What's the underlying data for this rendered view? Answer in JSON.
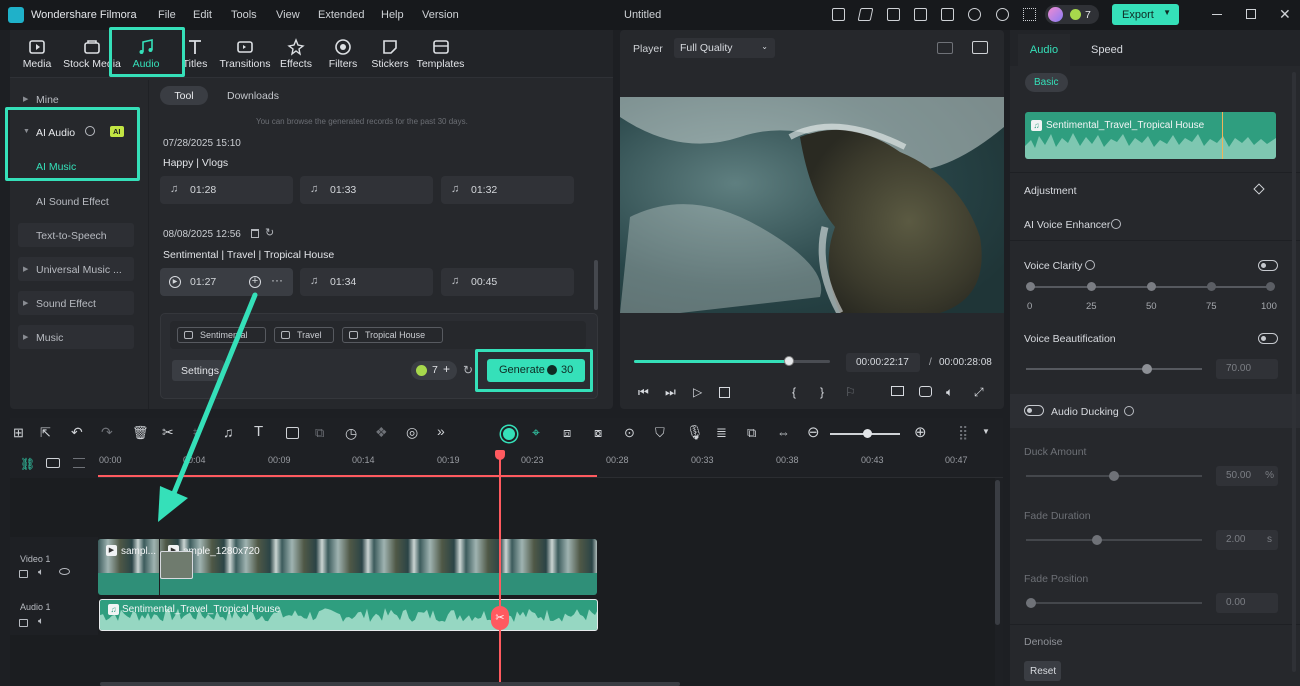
{
  "app": {
    "name": "Wondershare Filmora",
    "doc_title": "Untitled",
    "credits": "7",
    "export_label": "Export"
  },
  "menu": [
    "File",
    "Edit",
    "Tools",
    "View",
    "Extended",
    "Help",
    "Version"
  ],
  "toptabs": [
    "Media",
    "Stock Media",
    "Audio",
    "Titles",
    "Transitions",
    "Effects",
    "Filters",
    "Stickers",
    "Templates"
  ],
  "sidebar": {
    "mine": "Mine",
    "ai_audio": "AI Audio",
    "ai_badge": "AI",
    "ai_music": "AI Music",
    "ai_sound": "AI Sound Effect",
    "tts": "Text-to-Speech",
    "universal": "Universal Music ...",
    "sound_effect": "Sound Effect",
    "music": "Music"
  },
  "subtabs": {
    "tool": "Tool",
    "downloads": "Downloads"
  },
  "notice": "You can browse the generated records for the past 30 days.",
  "group1": {
    "date": "07/28/2025 15:10",
    "title": "Happy | Vlogs",
    "tracks": [
      "01:28",
      "01:33",
      "01:32"
    ]
  },
  "group2": {
    "date": "08/08/2025 12:56",
    "title": "Sentimental | Travel | Tropical House",
    "tracks": [
      "01:27",
      "01:34",
      "00:45"
    ]
  },
  "generator": {
    "tags": [
      "Sentimental",
      "Travel",
      "Tropical House"
    ],
    "settings": "Settings",
    "count": "7",
    "generate": "Generate",
    "cost": "30"
  },
  "player": {
    "label": "Player",
    "quality": "Full Quality",
    "current": "00:00:22:17",
    "sep": "/",
    "total": "00:00:28:08",
    "progress": 0.79
  },
  "right": {
    "tab_audio": "Audio",
    "tab_speed": "Speed",
    "basic": "Basic",
    "clip_name": "Sentimental_Travel_Tropical House",
    "adjustment": "Adjustment",
    "enhancer": "AI Voice Enhancer",
    "voice_clarity": "Voice Clarity",
    "scale": [
      "0",
      "25",
      "50",
      "75",
      "100"
    ],
    "beautification": "Voice Beautification",
    "beautification_value": "70.00",
    "ducking": "Audio Ducking",
    "duck_amount": "Duck Amount",
    "duck_value": "50.00",
    "duck_unit": "%",
    "fade_duration": "Fade Duration",
    "fade_duration_value": "2.00",
    "fade_unit": "s",
    "fade_position": "Fade Position",
    "fade_position_value": "0.00",
    "denoise": "Denoise",
    "reset": "Reset"
  },
  "timeline": {
    "ruler": [
      "00:00",
      "00:04",
      "00:09",
      "00:14",
      "00:19",
      "00:23",
      "00:28",
      "00:33",
      "00:38",
      "00:43",
      "00:47"
    ],
    "video_track": "Video 1",
    "audio_track": "Audio 1",
    "clip1": "sampl...",
    "clip2": "ample_1280x720",
    "audio_clip": "Sentimental_Travel_Tropical House"
  },
  "colors": {
    "accent": "#35e0b9",
    "playhead": "#ff5a5f",
    "audio_clip": "#2f9e7f"
  }
}
